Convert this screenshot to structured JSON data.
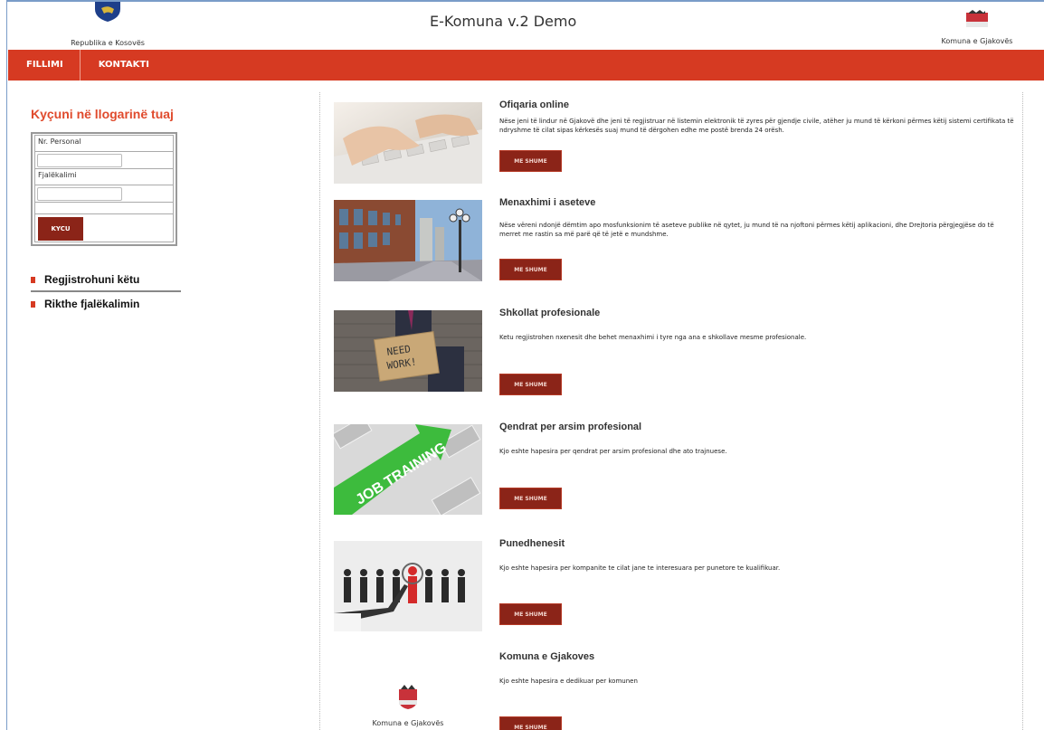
{
  "header": {
    "left_caption": "Republika e Kosovës",
    "title": "E-Komuna v.2 Demo",
    "right_caption": "Komuna e Gjakovës"
  },
  "nav": {
    "items": [
      {
        "label": "FILLIMI"
      },
      {
        "label": "KONTAKTI"
      }
    ]
  },
  "login": {
    "title": "Kyçuni në llogarinë tuaj",
    "personal_label": "Nr. Personal",
    "password_label": "Fjalëkalimi",
    "personal_value": "",
    "password_value": "",
    "submit_label": "KYCU"
  },
  "side_links": [
    {
      "label": "Regjistrohuni këtu"
    },
    {
      "label": "Rikthe fjalëkalimin"
    }
  ],
  "cards": [
    {
      "title": "Ofiqaria online",
      "text": "Nëse jeni të lindur në Gjakovë dhe jeni të regjistruar në listemin elektronik të zyres për gjendje civile, atëher ju mund të kërkoni përmes këtij sistemi certifikata të ndryshme të cilat sipas kërkesës suaj mund të dërgohen edhe me postë brenda 24 orësh.",
      "button": "ME SHUME"
    },
    {
      "title": "Menaxhimi i aseteve",
      "text": "Nëse vëreni ndonjë dëmtim apo mosfunksionim të aseteve publike në qytet, ju  mund të na njoftoni përmes këtij aplikacioni, dhe Drejtoria përgjegjëse do të merret me rastin sa më parë që të jetë e mundshme.",
      "button": "ME SHUME"
    },
    {
      "title": "Shkollat profesionale",
      "text": "Ketu regjistrohen nxenesit dhe behet menaxhimi i tyre nga ana e shkollave mesme profesionale.",
      "button": "ME SHUME",
      "sign_text": [
        "NEED",
        "WORK!"
      ]
    },
    {
      "title": "Qendrat per arsim profesional",
      "text": "Kjo eshte hapesira per qendrat per arsim profesional dhe ato trajnuese.",
      "button": "ME SHUME",
      "sign_text": "JOB TRAINING"
    },
    {
      "title": "Punedhenesit",
      "text": "Kjo eshte hapesira per kompanite te cilat jane te interesuara per punetore te kualifikuar.",
      "button": "ME SHUME"
    },
    {
      "title": "Komuna e Gjakoves",
      "text": "Kjo eshte hapesira e dedikuar per komunen",
      "button": "ME SHUME",
      "thumb_caption": "Komuna e Gjakovës"
    }
  ],
  "colors": {
    "nav": "#d63a22",
    "button": "#8b2418",
    "login_title": "#e04a2c"
  }
}
